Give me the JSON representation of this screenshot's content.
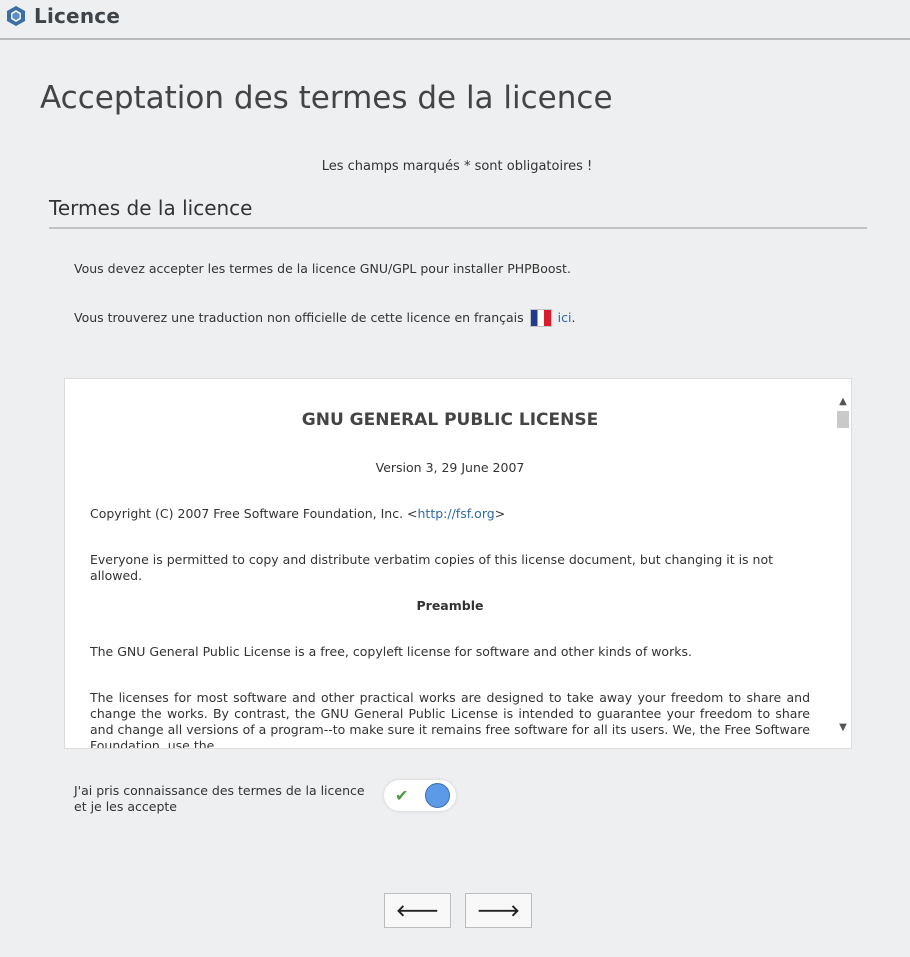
{
  "header": {
    "app_title": "Licence",
    "logo_icon": "phpboost-logo-icon"
  },
  "page": {
    "title": "Acceptation des termes de la licence",
    "required_note": "Les champs marqués * sont obligatoires !"
  },
  "section": {
    "title": "Termes de la licence",
    "info_1": "Vous devez accepter les termes de la licence GNU/GPL pour installer PHPBoost.",
    "info_2_prefix": "Vous trouverez une traduction non officielle de cette licence en français",
    "info_2_flag_icon": "french-flag-icon",
    "info_2_link": "ici",
    "info_2_suffix": "."
  },
  "license": {
    "heading": "GNU GENERAL PUBLIC LICENSE",
    "version": "Version 3, 29 June 2007",
    "copyright_prefix": "Copyright (C) 2007 Free Software Foundation, Inc. <",
    "copyright_link": "http://fsf.org",
    "copyright_suffix": ">",
    "permission": "Everyone is permitted to copy and distribute verbatim copies of this license document, but changing it is not allowed.",
    "preamble_title": "Preamble",
    "para_1": "The GNU General Public License is a free, copyleft license for software and other kinds of works.",
    "para_2": "The licenses for most software and other practical works are designed to take away your freedom to share and change the works. By contrast, the GNU General Public License is intended to guarantee your freedom to share and change all versions of a program--to make sure it remains free software for all its users. We, the Free Software Foundation, use the"
  },
  "accept": {
    "label": "J'ai pris connaissance des termes de la licence et je les accepte",
    "checked": true,
    "check_icon": "check-icon"
  },
  "nav": {
    "prev_icon": "arrow-left-icon",
    "next_icon": "arrow-right-icon",
    "prev_glyph": "🡐",
    "next_glyph": "🡒"
  },
  "colors": {
    "accent": "#5c9ae8",
    "link": "#2e6aa8",
    "check": "#4a9b48"
  }
}
